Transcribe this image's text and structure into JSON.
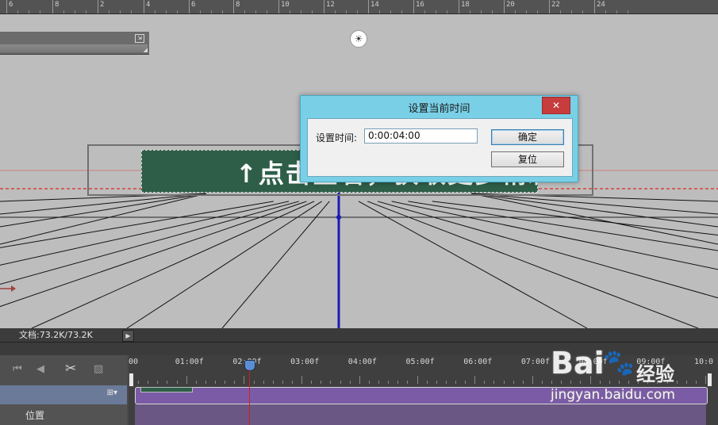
{
  "ruler": {
    "labels": [
      "6",
      "8",
      "2",
      "4",
      "6",
      "8",
      "10",
      "12",
      "14",
      "16",
      "18",
      "20",
      "22",
      "24"
    ]
  },
  "banner": {
    "text": "↑点击查看，获取更多精彩"
  },
  "status_bar": {
    "doc_info": "文档:73.2K/73.2K",
    "play_glyph": "▶"
  },
  "timeline": {
    "ticks": [
      "00",
      "01:00f",
      "02:00f",
      "03:00f",
      "04:00f",
      "05:00f",
      "06:00f",
      "07:00f",
      "08:00f",
      "09:00f",
      "10:0"
    ],
    "property_label": "位置",
    "controls": [
      "⏮",
      "◀",
      "✂",
      "▨"
    ],
    "layer_icon": "⊞▾"
  },
  "dialog": {
    "title": "设置当前时间",
    "close_glyph": "✕",
    "field_label": "设置时间:",
    "field_value": "0:00:04:00",
    "ok_label": "确定",
    "reset_label": "复位"
  },
  "watermark": {
    "brand": "Bai",
    "paw": "🐾",
    "cn": "经验",
    "url": "jingyan.baidu.com"
  },
  "colors": {
    "dialog_title_bar": "#79d0e6",
    "close_button": "#c73c3c",
    "banner_bg": "#2e5e48",
    "clip_track": "#7b5aa6",
    "axis_line": "#1a1ab8",
    "playhead_line": "#d02020"
  }
}
